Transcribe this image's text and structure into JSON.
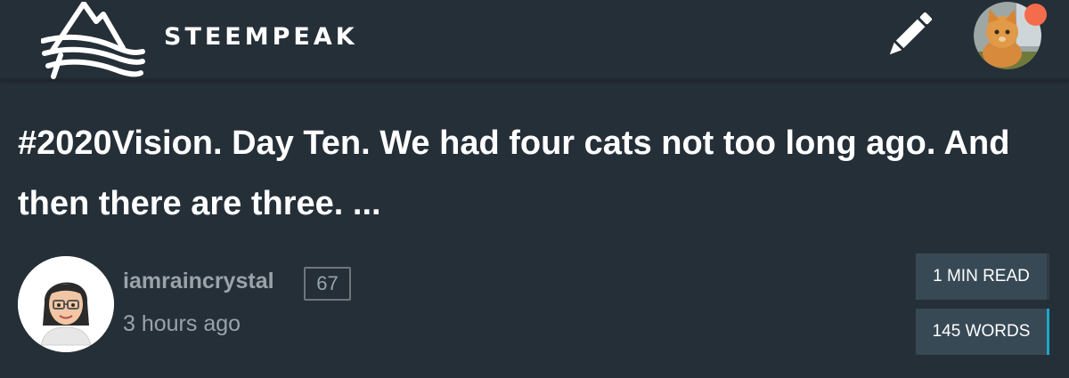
{
  "header": {
    "brand": "STEEMPEAK",
    "logo_icon": "mountain-logo-icon",
    "compose_icon": "pencil-icon",
    "user_avatar_icon": "kitten-avatar",
    "notification_color": "#f56c4c"
  },
  "post": {
    "title": "#2020Vision. Day Ten. We had four cats not too long ago. And then there are three. ...",
    "author": "iamraincrystal",
    "reputation": "67",
    "time": "3 hours ago",
    "read_time": "1 MIN READ",
    "word_count": "145 WORDS"
  },
  "colors": {
    "background": "#252f38",
    "chip_background": "#374955",
    "accent": "#1fa6c7",
    "muted_text": "#9aa3aa"
  }
}
